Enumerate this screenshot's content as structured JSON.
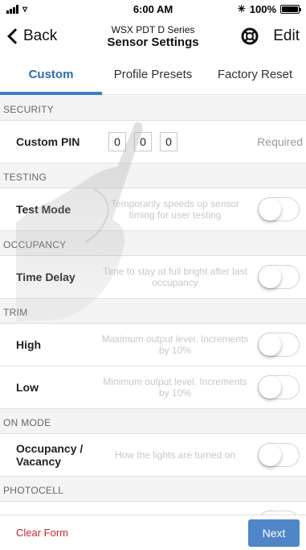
{
  "status_bar": {
    "time": "6:00 AM",
    "battery": "100%",
    "battery_level": 1.0
  },
  "nav": {
    "back_label": "Back",
    "subtitle": "WSX PDT D Series",
    "title": "Sensor Settings",
    "edit_label": "Edit",
    "help_icon": "lifebuoy-icon"
  },
  "tabs": [
    {
      "label": "Custom",
      "active": true
    },
    {
      "label": "Profile Presets",
      "active": false
    },
    {
      "label": "Factory Reset",
      "active": false
    }
  ],
  "sections": {
    "security": {
      "header": "SECURITY",
      "pin_label": "Custom PIN",
      "pin_digits": [
        "0",
        "0",
        "0"
      ],
      "pin_required": "Required"
    },
    "testing": {
      "header": "TESTING",
      "test_mode": {
        "label": "Test Mode",
        "description": "Temporarily speeds up sensor timing for user testing",
        "on": false
      }
    },
    "occupancy": {
      "header": "OCCUPANCY",
      "time_delay": {
        "label": "Time Delay",
        "description": "Time to stay at full bright after last occupancy",
        "on": false
      }
    },
    "trim": {
      "header": "TRIM",
      "high": {
        "label": "High",
        "description": "Maximum output level. Increments by 10%",
        "on": false
      },
      "low": {
        "label": "Low",
        "description": "Minimum output level. Increments by 10%",
        "on": false
      }
    },
    "on_mode": {
      "header": "ON MODE",
      "occ_vac": {
        "label": "Occupancy / Vacancy",
        "description": "How the lights are turned on",
        "on": false
      }
    },
    "photocell": {
      "header": "PHOTOCELL"
    }
  },
  "footer": {
    "clear_label": "Clear Form",
    "next_label": "Next"
  },
  "colors": {
    "accent": "#3d7ec4",
    "tab_active_text": "#2f6dad",
    "clear_text": "#d0242b",
    "next_bg": "#4f86c7",
    "section_bg": "#f4f4f4"
  }
}
